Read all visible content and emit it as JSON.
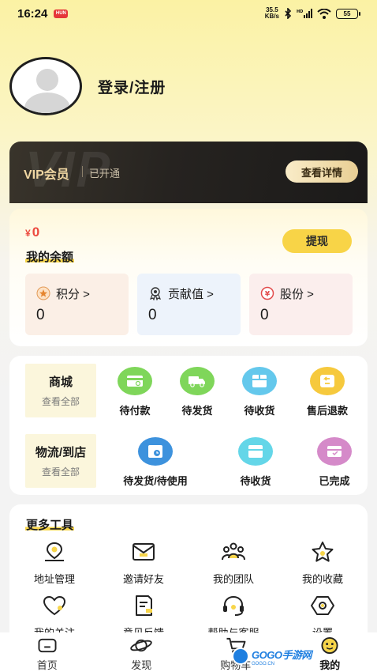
{
  "status_bar": {
    "time": "16:24",
    "app_badge": "HUN",
    "speed_top": "35.5",
    "speed_bottom": "KB/s",
    "battery": "55"
  },
  "profile": {
    "login_label": "登录/注册"
  },
  "vip": {
    "watermark": "VIP",
    "title": "VIP会员",
    "status": "已开通",
    "details_button": "查看详情"
  },
  "balance": {
    "currency": "¥",
    "amount": "0",
    "label": "我的余额",
    "withdraw_button": "提现",
    "stats": [
      {
        "label": "积分 >",
        "value": "0"
      },
      {
        "label": "贡献值 >",
        "value": "0"
      },
      {
        "label": "股份 >",
        "value": "0"
      }
    ]
  },
  "mall": {
    "title": "商城",
    "subtitle": "查看全部",
    "items": [
      {
        "label": "待付款",
        "icon": "payment-icon",
        "color": "#7fd65a"
      },
      {
        "label": "待发货",
        "icon": "truck-icon",
        "color": "#7fd65a"
      },
      {
        "label": "待收货",
        "icon": "package-icon",
        "color": "#64c8ec"
      },
      {
        "label": "售后退款",
        "icon": "refund-icon",
        "color": "#f6c93d"
      }
    ]
  },
  "logistics": {
    "title": "物流/到店",
    "subtitle": "查看全部",
    "items": [
      {
        "label": "待发货/待使用",
        "icon": "pending-use-icon",
        "color": "#3d92dd"
      },
      {
        "label": "待收货",
        "icon": "receive-icon",
        "color": "#64d6e8"
      },
      {
        "label": "已完成",
        "icon": "completed-icon",
        "color": "#d58ac9"
      }
    ]
  },
  "tools": {
    "title": "更多工具",
    "items": [
      {
        "label": "地址管理",
        "icon": "location-icon"
      },
      {
        "label": "邀请好友",
        "icon": "invite-icon"
      },
      {
        "label": "我的团队",
        "icon": "team-icon"
      },
      {
        "label": "我的收藏",
        "icon": "star-icon"
      },
      {
        "label": "我的关注",
        "icon": "heart-icon"
      },
      {
        "label": "意见反馈",
        "icon": "feedback-icon"
      },
      {
        "label": "帮助与客服",
        "icon": "headset-icon"
      },
      {
        "label": "设置",
        "icon": "settings-icon"
      }
    ]
  },
  "tabs": [
    {
      "label": "首页"
    },
    {
      "label": "发现"
    },
    {
      "label": "购物车"
    },
    {
      "label": "我的"
    }
  ],
  "watermark": {
    "text": "GOGO手游网",
    "sub": "GOGO.CN"
  }
}
